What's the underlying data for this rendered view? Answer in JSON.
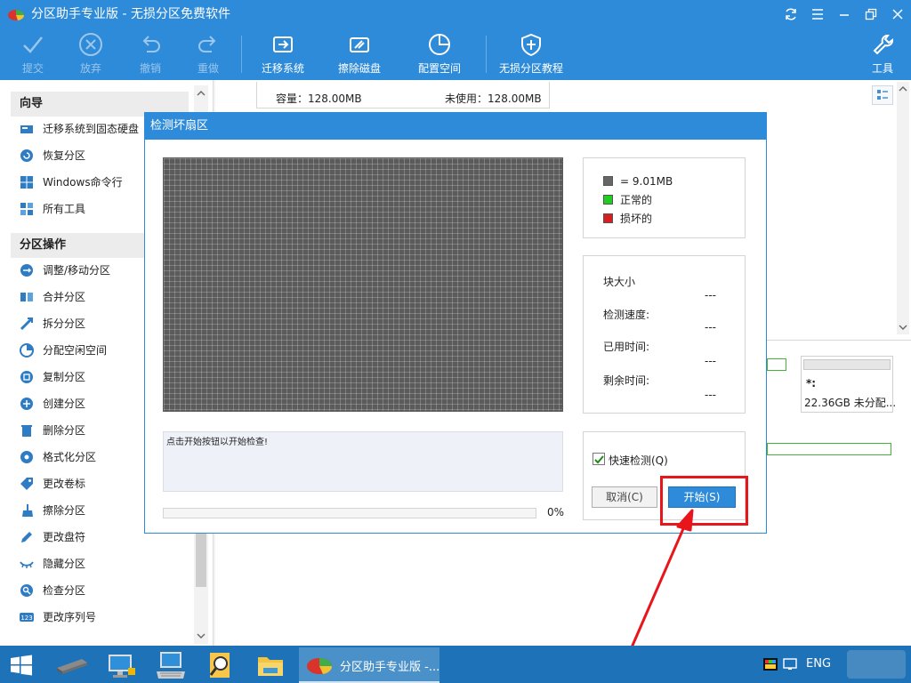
{
  "window": {
    "title": "分区助手专业版 - 无损分区免费软件"
  },
  "toolbar": {
    "items": [
      {
        "label": "提交",
        "icon": "check-icon",
        "enabled": false
      },
      {
        "label": "放弃",
        "icon": "discard-icon",
        "enabled": false
      },
      {
        "label": "撤销",
        "icon": "undo-icon",
        "enabled": false
      },
      {
        "label": "重做",
        "icon": "redo-icon",
        "enabled": false
      },
      {
        "label": "迁移系统",
        "icon": "migrate-icon",
        "enabled": true
      },
      {
        "label": "擦除磁盘",
        "icon": "wipe-disk-icon",
        "enabled": true
      },
      {
        "label": "配置空间",
        "icon": "allocate-icon",
        "enabled": true
      },
      {
        "label": "无损分区教程",
        "icon": "shield-icon",
        "enabled": true
      },
      {
        "label": "工具",
        "icon": "wrench-icon",
        "enabled": true
      }
    ]
  },
  "sidebar": {
    "wizard_title": "向导",
    "wizard_items": [
      {
        "label": "迁移系统到固态硬盘",
        "icon": "disk-migrate-icon"
      },
      {
        "label": "恢复分区",
        "icon": "recover-icon"
      },
      {
        "label": "Windows命令行",
        "icon": "windows-icon"
      },
      {
        "label": "所有工具",
        "icon": "tools-icon"
      }
    ],
    "ops_title": "分区操作",
    "ops_items": [
      {
        "label": "调整/移动分区",
        "icon": "resize-icon"
      },
      {
        "label": "合并分区",
        "icon": "merge-icon"
      },
      {
        "label": "拆分分区",
        "icon": "split-icon"
      },
      {
        "label": "分配空闲空间",
        "icon": "pie-icon"
      },
      {
        "label": "复制分区",
        "icon": "copy-icon"
      },
      {
        "label": "创建分区",
        "icon": "create-icon"
      },
      {
        "label": "删除分区",
        "icon": "trash-icon"
      },
      {
        "label": "格式化分区",
        "icon": "format-icon"
      },
      {
        "label": "更改卷标",
        "icon": "tag-icon"
      },
      {
        "label": "擦除分区",
        "icon": "broom-icon"
      },
      {
        "label": "更改盘符",
        "icon": "pencil-icon"
      },
      {
        "label": "隐藏分区",
        "icon": "eye-hidden-icon"
      },
      {
        "label": "检查分区",
        "icon": "search-icon"
      },
      {
        "label": "更改序列号",
        "icon": "serial-icon"
      }
    ]
  },
  "main": {
    "capacity": "容量：128.00MB",
    "unused": "未使用：128.00MB",
    "partition_letter": "*:",
    "partition_desc": "22.36GB 未分配..."
  },
  "dialog": {
    "title": "检测坏扇区",
    "legend": [
      {
        "label": "= 9.01MB",
        "color": "#666666"
      },
      {
        "label": "正常的",
        "color": "#1fce1f"
      },
      {
        "label": "损坏的",
        "color": "#d81e1e"
      }
    ],
    "stats": [
      {
        "label": "块大小",
        "value": "---"
      },
      {
        "label": "检测速度:",
        "value": "---"
      },
      {
        "label": "已用时间:",
        "value": "---"
      },
      {
        "label": "剩余时间:",
        "value": "---"
      }
    ],
    "message": "点击开始按钮以开始检查!",
    "progress_percent": 0,
    "progress_text": "0%",
    "quick_check": {
      "label": "快速检测(Q)",
      "checked": true
    },
    "cancel_label": "取消(C)",
    "start_label": "开始(S)"
  },
  "taskbar": {
    "active_app": "分区助手专业版 -...",
    "language": "ENG",
    "pinned": [
      "start-icon",
      "device-manager-icon",
      "network-pc-icon",
      "keyboard-pc-icon",
      "search-tool-icon",
      "folder-icon"
    ]
  },
  "colors": {
    "accent": "#2e8bd9",
    "highlight": "#e8161a"
  }
}
